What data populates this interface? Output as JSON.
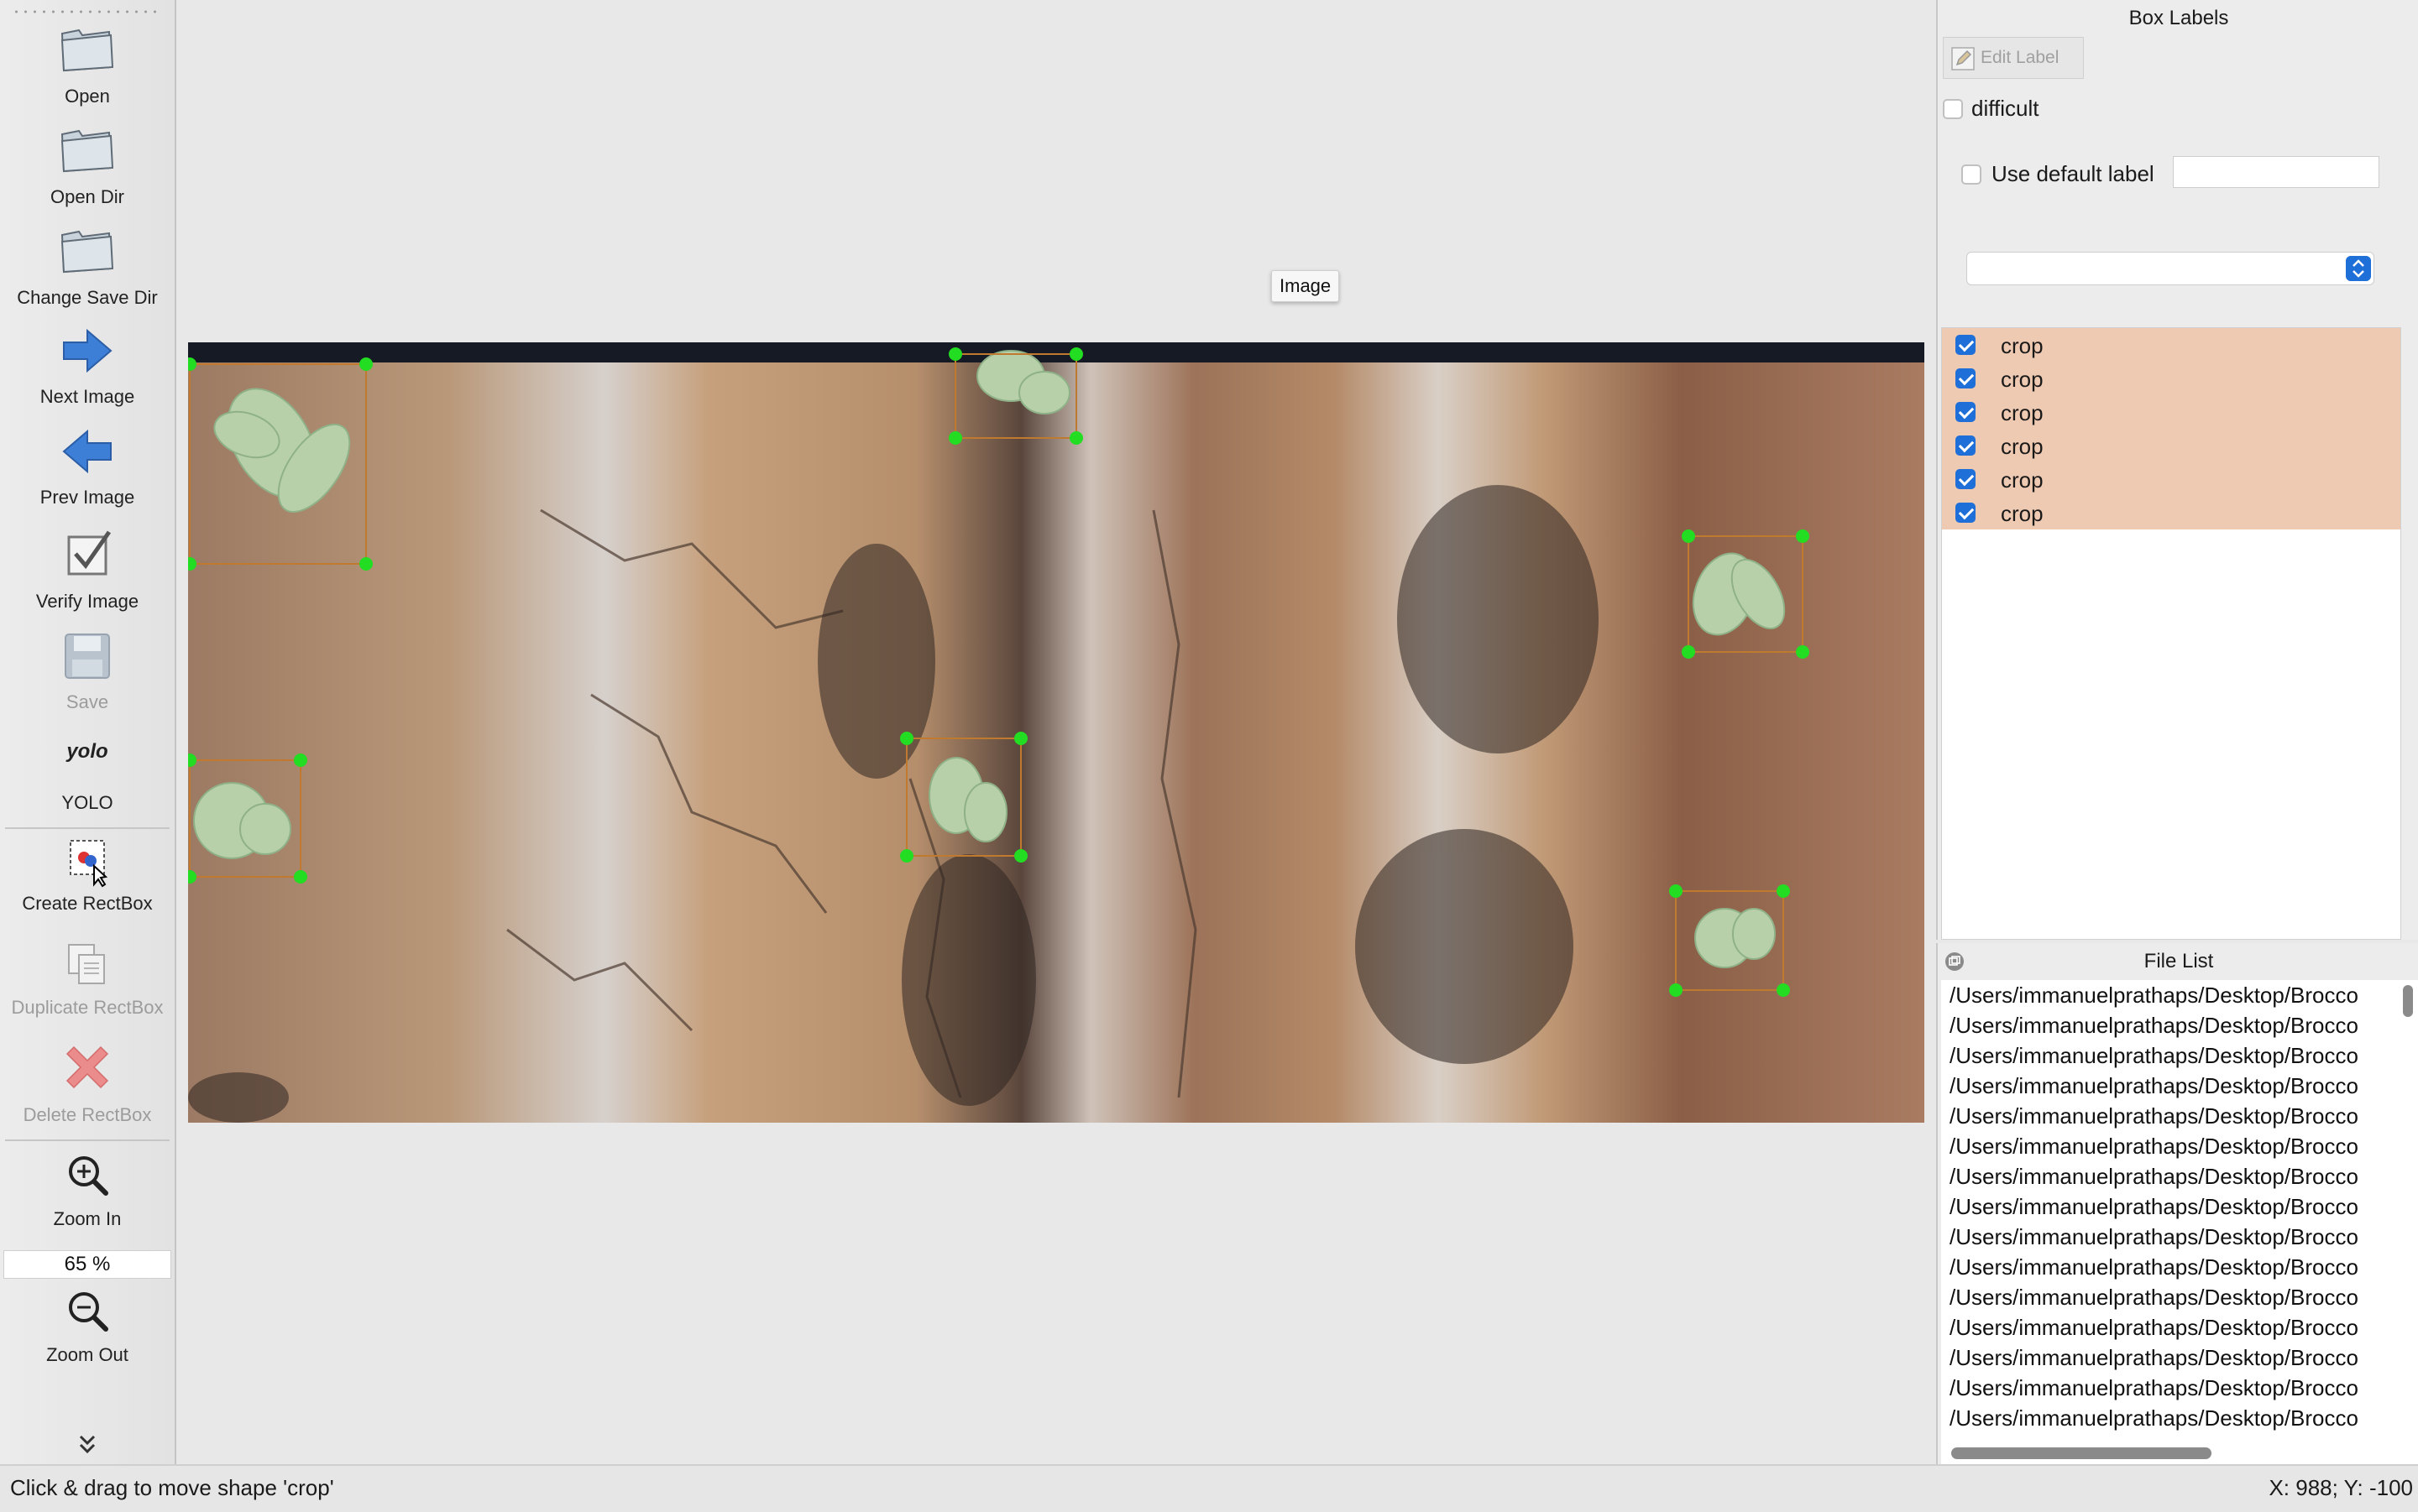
{
  "toolbar": {
    "open": "Open",
    "open_dir": "Open Dir",
    "change_save_dir": "Change Save Dir",
    "next_image": "Next Image",
    "prev_image": "Prev Image",
    "verify_image": "Verify Image",
    "save": "Save",
    "yolo_icon_text": "yolo",
    "yolo": "YOLO",
    "create_rectbox": "Create RectBox",
    "duplicate_rectbox": "Duplicate RectBox",
    "delete_rectbox": "Delete RectBox",
    "zoom_in": "Zoom In",
    "zoom_value": "65 %",
    "zoom_out": "Zoom Out"
  },
  "canvas": {
    "tooltip": "Image"
  },
  "box_labels": {
    "title": "Box Labels",
    "edit_label": "Edit Label",
    "difficult": "difficult",
    "difficult_checked": false,
    "use_default_label": "Use default label",
    "use_default_checked": false,
    "default_label_value": "",
    "combo_value": "",
    "items": [
      {
        "label": "crop",
        "checked": true
      },
      {
        "label": "crop",
        "checked": true
      },
      {
        "label": "crop",
        "checked": true
      },
      {
        "label": "crop",
        "checked": true
      },
      {
        "label": "crop",
        "checked": true
      },
      {
        "label": "crop",
        "checked": true
      }
    ],
    "highlight_color": "#efcab2"
  },
  "file_list": {
    "title": "File List",
    "rows": [
      "/Users/immanuelprathaps/Desktop/Brocco",
      "/Users/immanuelprathaps/Desktop/Brocco",
      "/Users/immanuelprathaps/Desktop/Brocco",
      "/Users/immanuelprathaps/Desktop/Brocco",
      "/Users/immanuelprathaps/Desktop/Brocco",
      "/Users/immanuelprathaps/Desktop/Brocco",
      "/Users/immanuelprathaps/Desktop/Brocco",
      "/Users/immanuelprathaps/Desktop/Brocco",
      "/Users/immanuelprathaps/Desktop/Brocco",
      "/Users/immanuelprathaps/Desktop/Brocco",
      "/Users/immanuelprathaps/Desktop/Brocco",
      "/Users/immanuelprathaps/Desktop/Brocco",
      "/Users/immanuelprathaps/Desktop/Brocco",
      "/Users/immanuelprathaps/Desktop/Brocco",
      "/Users/immanuelprathaps/Desktop/Brocco"
    ]
  },
  "status": {
    "message": "Click & drag to move shape 'crop'",
    "coords": "X: 988; Y: -100"
  },
  "colors": {
    "handle": "#22dd22",
    "box_outline": "#c07a30",
    "accent": "#1f6fd8",
    "next_arrow": "#3d7fd6"
  }
}
